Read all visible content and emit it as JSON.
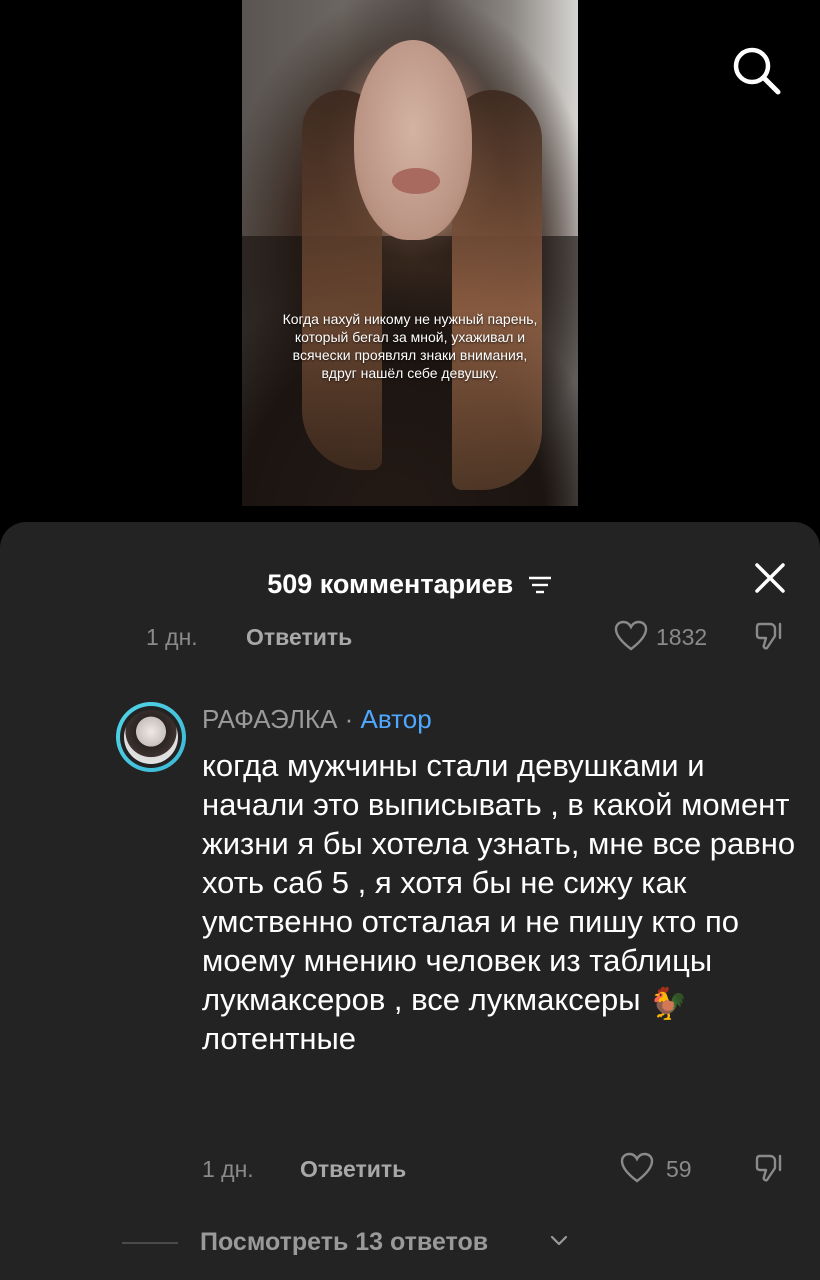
{
  "video": {
    "caption": "Когда нахуй никому не нужный парень, который бегал за мной, ухаживал и всячески проявлял знаки внимания, вдруг нашёл себе девушку."
  },
  "comments_sheet": {
    "title": "509 комментариев",
    "prev_comment": {
      "time": "1 дн.",
      "reply_label": "Ответить",
      "likes": "1832"
    },
    "comment": {
      "author": "РАФАЭЛКА",
      "separator": " · ",
      "author_badge": "Автор",
      "text": "когда мужчины стали девушками и начали это выписывать , в какой момент жизни я бы хотела узнать, мне все равно хоть саб 5 , я хотя бы не сижу как умственно отсталая и не пишу кто по моему мнению человек из таблицы лукмаксеров , все лукмаксеры",
      "text_end": "лотентные",
      "emoji": "🐓",
      "time": "1 дн.",
      "reply_label": "Ответить",
      "likes": "59"
    },
    "view_replies_label": "Посмотреть 13 ответов"
  },
  "icons": [
    "search-icon",
    "filter-icon",
    "close-icon",
    "heart-icon",
    "dislike-icon",
    "rooster-emoji-icon",
    "chevron-down-icon"
  ],
  "colors": {
    "sheet_bg": "#232323",
    "author_badge": "#4fa8ff",
    "avatar_ring": "#52d6e8"
  }
}
